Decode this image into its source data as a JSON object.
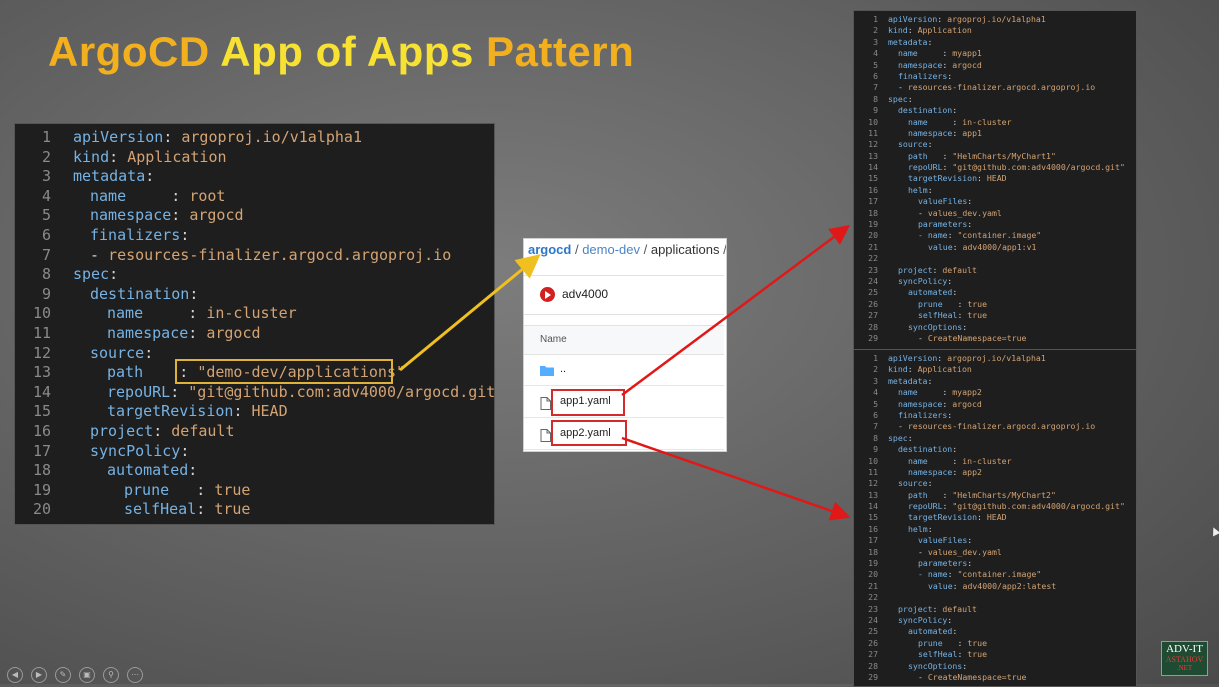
{
  "title": {
    "part1": "ArgoCD",
    "part2": "App of Apps",
    "part3": "Pattern"
  },
  "main_code": [
    {
      "n": "1",
      "key": "apiVersion",
      "sep": ": ",
      "val": "argoproj.io/v1alpha1",
      "indent": 0
    },
    {
      "n": "2",
      "key": "kind",
      "sep": ": ",
      "val": "Application",
      "indent": 0
    },
    {
      "n": "3",
      "key": "metadata",
      "sep": ":",
      "val": "",
      "indent": 0
    },
    {
      "n": "4",
      "key": "name",
      "sep": "     : ",
      "val": "root",
      "indent": 1
    },
    {
      "n": "5",
      "key": "namespace",
      "sep": ": ",
      "val": "argocd",
      "indent": 1
    },
    {
      "n": "6",
      "key": "finalizers",
      "sep": ":",
      "val": "",
      "indent": 1
    },
    {
      "n": "7",
      "key": "",
      "sep": "- ",
      "val": "resources-finalizer.argocd.argoproj.io",
      "indent": 1
    },
    {
      "n": "8",
      "key": "spec",
      "sep": ":",
      "val": "",
      "indent": 0
    },
    {
      "n": "9",
      "key": "destination",
      "sep": ":",
      "val": "",
      "indent": 1
    },
    {
      "n": "10",
      "key": "name",
      "sep": "     : ",
      "val": "in-cluster",
      "indent": 2
    },
    {
      "n": "11",
      "key": "namespace",
      "sep": ": ",
      "val": "argocd",
      "indent": 2
    },
    {
      "n": "12",
      "key": "source",
      "sep": ":",
      "val": "",
      "indent": 1
    },
    {
      "n": "13",
      "key": "path",
      "sep": "    : ",
      "val": "\"demo-dev/applications\"",
      "indent": 2
    },
    {
      "n": "14",
      "key": "repoURL",
      "sep": ": ",
      "val": "\"git@github.com:adv4000/argocd.git\"",
      "indent": 2
    },
    {
      "n": "15",
      "key": "targetRevision",
      "sep": ": ",
      "val": "HEAD",
      "indent": 2
    },
    {
      "n": "16",
      "key": "project",
      "sep": ": ",
      "val": "default",
      "indent": 1
    },
    {
      "n": "17",
      "key": "syncPolicy",
      "sep": ":",
      "val": "",
      "indent": 1
    },
    {
      "n": "18",
      "key": "automated",
      "sep": ":",
      "val": "",
      "indent": 2
    },
    {
      "n": "19",
      "key": "prune",
      "sep": "   : ",
      "val": "true",
      "indent": 3
    },
    {
      "n": "20",
      "key": "selfHeal",
      "sep": ": ",
      "val": "true",
      "indent": 3
    }
  ],
  "app1_code": [
    {
      "n": "1",
      "key": "apiVersion",
      "sep": ": ",
      "val": "argoproj.io/v1alpha1",
      "indent": 0
    },
    {
      "n": "2",
      "key": "kind",
      "sep": ": ",
      "val": "Application",
      "indent": 0
    },
    {
      "n": "3",
      "key": "metadata",
      "sep": ":",
      "val": "",
      "indent": 0
    },
    {
      "n": "4",
      "key": "name",
      "sep": "     : ",
      "val": "myapp1",
      "indent": 1
    },
    {
      "n": "5",
      "key": "namespace",
      "sep": ": ",
      "val": "argocd",
      "indent": 1
    },
    {
      "n": "6",
      "key": "finalizers",
      "sep": ":",
      "val": "",
      "indent": 1
    },
    {
      "n": "7",
      "key": "",
      "sep": "- ",
      "val": "resources-finalizer.argocd.argoproj.io",
      "indent": 1
    },
    {
      "n": "8",
      "key": "spec",
      "sep": ":",
      "val": "",
      "indent": 0
    },
    {
      "n": "9",
      "key": "destination",
      "sep": ":",
      "val": "",
      "indent": 1
    },
    {
      "n": "10",
      "key": "name",
      "sep": "     : ",
      "val": "in-cluster",
      "indent": 2
    },
    {
      "n": "11",
      "key": "namespace",
      "sep": ": ",
      "val": "app1",
      "indent": 2
    },
    {
      "n": "12",
      "key": "source",
      "sep": ":",
      "val": "",
      "indent": 1
    },
    {
      "n": "13",
      "key": "path",
      "sep": "   : ",
      "val": "\"HelmCharts/MyChart1\"",
      "indent": 2
    },
    {
      "n": "14",
      "key": "repoURL",
      "sep": ": ",
      "val": "\"git@github.com:adv4000/argocd.git\"",
      "indent": 2
    },
    {
      "n": "15",
      "key": "targetRevision",
      "sep": ": ",
      "val": "HEAD",
      "indent": 2
    },
    {
      "n": "16",
      "key": "helm",
      "sep": ":",
      "val": "",
      "indent": 2
    },
    {
      "n": "17",
      "key": "valueFiles",
      "sep": ":",
      "val": "",
      "indent": 3
    },
    {
      "n": "18",
      "key": "",
      "sep": "- ",
      "val": "values_dev.yaml",
      "indent": 3
    },
    {
      "n": "19",
      "key": "parameters",
      "sep": ":",
      "val": "",
      "indent": 3
    },
    {
      "n": "20",
      "key": "- name",
      "sep": ": ",
      "val": "\"container.image\"",
      "indent": 3
    },
    {
      "n": "21",
      "key": "value",
      "sep": ": ",
      "val": "adv4000/app1:v1",
      "indent": 4
    },
    {
      "n": "22",
      "key": "",
      "sep": "",
      "val": "",
      "indent": 0
    },
    {
      "n": "23",
      "key": "project",
      "sep": ": ",
      "val": "default",
      "indent": 1
    },
    {
      "n": "24",
      "key": "syncPolicy",
      "sep": ":",
      "val": "",
      "indent": 1
    },
    {
      "n": "25",
      "key": "automated",
      "sep": ":",
      "val": "",
      "indent": 2
    },
    {
      "n": "26",
      "key": "prune",
      "sep": "   : ",
      "val": "true",
      "indent": 3
    },
    {
      "n": "27",
      "key": "selfHeal",
      "sep": ": ",
      "val": "true",
      "indent": 3
    },
    {
      "n": "28",
      "key": "syncOptions",
      "sep": ":",
      "val": "",
      "indent": 2
    },
    {
      "n": "29",
      "key": "",
      "sep": "- ",
      "val": "CreateNamespace=true",
      "indent": 3
    }
  ],
  "app2_code": [
    {
      "n": "1",
      "key": "apiVersion",
      "sep": ": ",
      "val": "argoproj.io/v1alpha1",
      "indent": 0
    },
    {
      "n": "2",
      "key": "kind",
      "sep": ": ",
      "val": "Application",
      "indent": 0
    },
    {
      "n": "3",
      "key": "metadata",
      "sep": ":",
      "val": "",
      "indent": 0
    },
    {
      "n": "4",
      "key": "name",
      "sep": "     : ",
      "val": "myapp2",
      "indent": 1
    },
    {
      "n": "5",
      "key": "namespace",
      "sep": ": ",
      "val": "argocd",
      "indent": 1
    },
    {
      "n": "6",
      "key": "finalizers",
      "sep": ":",
      "val": "",
      "indent": 1
    },
    {
      "n": "7",
      "key": "",
      "sep": "- ",
      "val": "resources-finalizer.argocd.argoproj.io",
      "indent": 1
    },
    {
      "n": "8",
      "key": "spec",
      "sep": ":",
      "val": "",
      "indent": 0
    },
    {
      "n": "9",
      "key": "destination",
      "sep": ":",
      "val": "",
      "indent": 1
    },
    {
      "n": "10",
      "key": "name",
      "sep": "     : ",
      "val": "in-cluster",
      "indent": 2
    },
    {
      "n": "11",
      "key": "namespace",
      "sep": ": ",
      "val": "app2",
      "indent": 2
    },
    {
      "n": "12",
      "key": "source",
      "sep": ":",
      "val": "",
      "indent": 1
    },
    {
      "n": "13",
      "key": "path",
      "sep": "   : ",
      "val": "\"HelmCharts/MyChart2\"",
      "indent": 2
    },
    {
      "n": "14",
      "key": "repoURL",
      "sep": ": ",
      "val": "\"git@github.com:adv4000/argocd.git\"",
      "indent": 2
    },
    {
      "n": "15",
      "key": "targetRevision",
      "sep": ": ",
      "val": "HEAD",
      "indent": 2
    },
    {
      "n": "16",
      "key": "helm",
      "sep": ":",
      "val": "",
      "indent": 2
    },
    {
      "n": "17",
      "key": "valueFiles",
      "sep": ":",
      "val": "",
      "indent": 3
    },
    {
      "n": "18",
      "key": "",
      "sep": "- ",
      "val": "values_dev.yaml",
      "indent": 3
    },
    {
      "n": "19",
      "key": "parameters",
      "sep": ":",
      "val": "",
      "indent": 3
    },
    {
      "n": "20",
      "key": "- name",
      "sep": ": ",
      "val": "\"container.image\"",
      "indent": 3
    },
    {
      "n": "21",
      "key": "value",
      "sep": ": ",
      "val": "adv4000/app2:latest",
      "indent": 4
    },
    {
      "n": "22",
      "key": "",
      "sep": "",
      "val": "",
      "indent": 0
    },
    {
      "n": "23",
      "key": "project",
      "sep": ": ",
      "val": "default",
      "indent": 1
    },
    {
      "n": "24",
      "key": "syncPolicy",
      "sep": ":",
      "val": "",
      "indent": 1
    },
    {
      "n": "25",
      "key": "automated",
      "sep": ":",
      "val": "",
      "indent": 2
    },
    {
      "n": "26",
      "key": "prune",
      "sep": "   : ",
      "val": "true",
      "indent": 3
    },
    {
      "n": "27",
      "key": "selfHeal",
      "sep": ": ",
      "val": "true",
      "indent": 3
    },
    {
      "n": "28",
      "key": "syncOptions",
      "sep": ":",
      "val": "",
      "indent": 2
    },
    {
      "n": "29",
      "key": "",
      "sep": "- ",
      "val": "CreateNamespace=true",
      "indent": 3
    }
  ],
  "browser": {
    "breadcrumb": {
      "root": "argocd",
      "mid": "demo-dev",
      "leaf": "applications",
      "sep": " / "
    },
    "owner": "adv4000",
    "column_header": "Name",
    "rows": [
      {
        "name": "..",
        "icon": "folder-icon"
      },
      {
        "name": "app1.yaml",
        "icon": "file-icon"
      },
      {
        "name": "app2.yaml",
        "icon": "file-icon"
      }
    ]
  },
  "logo": {
    "line1": "ADV-IT",
    "line2": "ASTAHOV",
    "line3": ".NET"
  },
  "controls": [
    "prev-icon",
    "next-icon",
    "pen-icon",
    "slides-icon",
    "zoom-icon",
    "more-icon"
  ],
  "colors": {
    "key": "#76b2e4",
    "value": "#d4a373",
    "highlight": "#e0b23a",
    "arrow_yellow": "#f0c020",
    "arrow_red": "#e01818"
  }
}
